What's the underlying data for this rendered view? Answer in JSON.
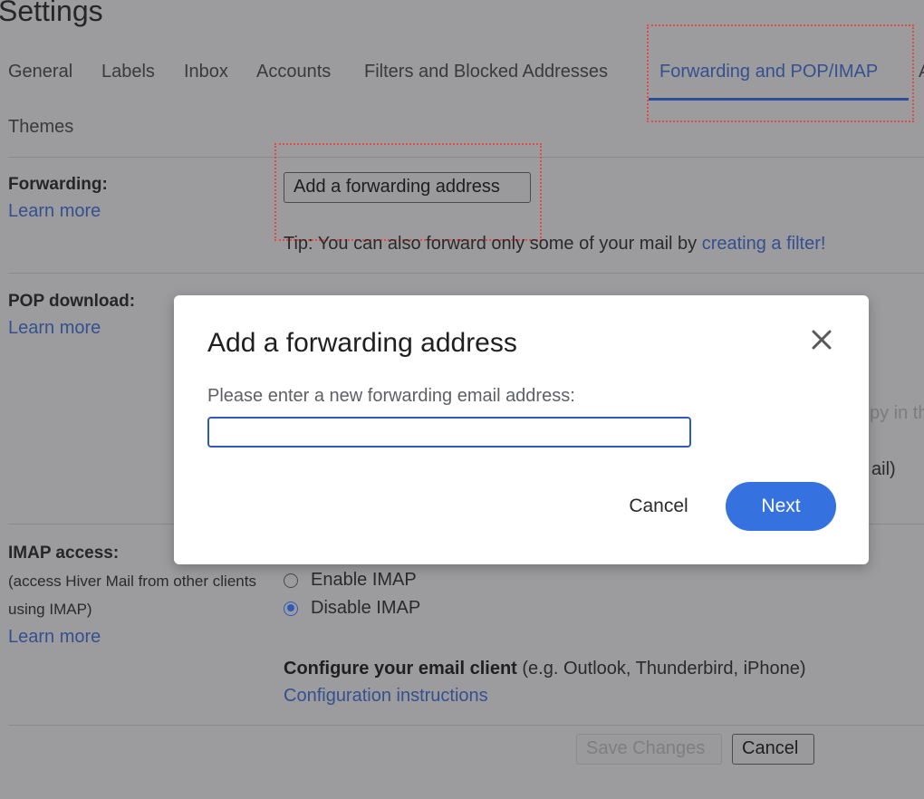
{
  "page": {
    "title": "Settings"
  },
  "tabs": [
    {
      "label": "General",
      "active": false
    },
    {
      "label": "Labels",
      "active": false
    },
    {
      "label": "Inbox",
      "active": false
    },
    {
      "label": "Accounts",
      "active": false
    },
    {
      "label": "Filters and Blocked Addresses",
      "active": false
    },
    {
      "label": "Forwarding and POP/IMAP",
      "active": true
    },
    {
      "label": "A",
      "active": false
    },
    {
      "label": "Themes",
      "active": false
    }
  ],
  "forwarding": {
    "label": "Forwarding:",
    "learn_more": "Learn more",
    "add_button": "Add a forwarding address",
    "tip_text": "Tip: You can also forward only some of your mail by ",
    "tip_link": "creating a filter!"
  },
  "pop": {
    "label": "POP download:",
    "learn_more": "Learn more",
    "peek_1": "py in th",
    "peek_2": "ail)"
  },
  "imap": {
    "label": "IMAP access:",
    "desc_line1": "(access Hiver Mail from other clients",
    "desc_line2": "using IMAP)",
    "learn_more": "Learn more",
    "options": [
      {
        "label": "Enable IMAP",
        "checked": false
      },
      {
        "label": "Disable IMAP",
        "checked": true
      }
    ],
    "configure_bold": "Configure your email client",
    "configure_rest": " (e.g. Outlook, Thunderbird, iPhone)",
    "config_link": "Configuration instructions"
  },
  "footer": {
    "save": "Save Changes",
    "cancel": "Cancel"
  },
  "modal": {
    "title": "Add a forwarding address",
    "close_icon": "close-icon",
    "label": "Please enter a new forwarding email address:",
    "input_value": "",
    "cancel": "Cancel",
    "next": "Next"
  },
  "colors": {
    "accent": "#3572e0",
    "active_tab": "#34508f",
    "highlight": "#e24a4a"
  }
}
